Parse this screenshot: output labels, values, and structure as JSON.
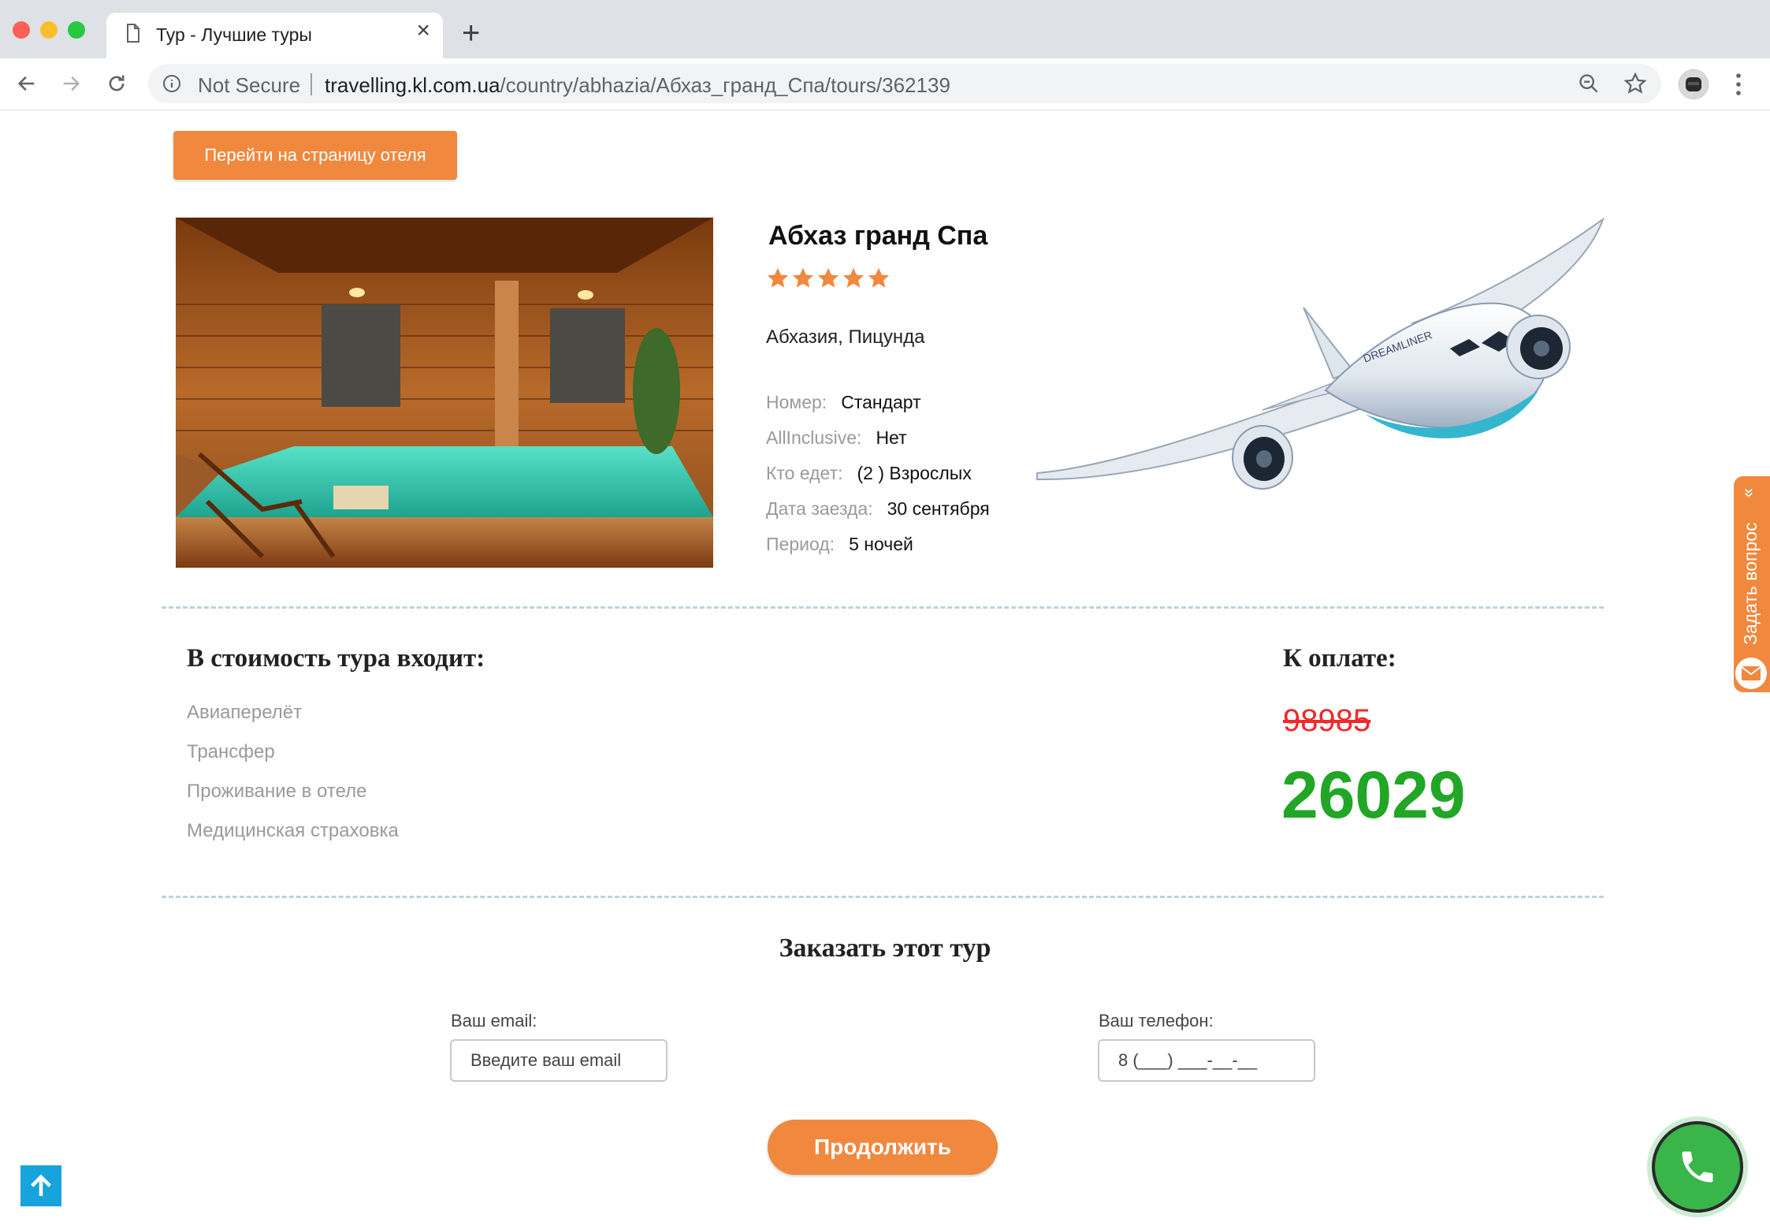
{
  "browser": {
    "tab_title": "Тур - Лучшие туры",
    "security_label": "Not Secure",
    "url_host": "travelling.kl.com.ua",
    "url_path": "/country/abhazia/Абхаз_гранд_Спа/tours/362139"
  },
  "page": {
    "hotel_page_button": "Перейти на страницу отеля",
    "hotel": {
      "name": "Абхаз гранд Спа",
      "stars": 5,
      "location": "Абхазия, Пицунда"
    },
    "params": [
      {
        "key": "Номер:",
        "value": "Стандарт"
      },
      {
        "key": "AllInclusive:",
        "value": "Нет"
      },
      {
        "key": "Кто едет:",
        "value": "(2 ) Взрослых"
      },
      {
        "key": "Дата заезда:",
        "value": "30 сентября"
      },
      {
        "key": "Период:",
        "value": "5 ночей"
      }
    ],
    "included_title": "В стоимость тура входит:",
    "included_items": [
      "Авиаперелёт",
      "Трансфер",
      "Проживание в отеле",
      "Медицинская страховка"
    ],
    "payment_title": "К оплате:",
    "old_price": "98985",
    "new_price": "26029",
    "order_title": "Заказать этот тур",
    "email_label": "Ваш email:",
    "email_placeholder": "Введите ваш email",
    "phone_label": "Ваш телефон:",
    "phone_placeholder": "8 (___) ___-__-__",
    "continue_button": "Продолжить",
    "ask_question": "Задать вопрос"
  },
  "colors": {
    "accent_orange": "#f0883e",
    "old_price_red": "#ee2a2a",
    "new_price_green": "#21a626",
    "call_green": "#39b54a",
    "scroll_blue": "#17a3db"
  },
  "icons": [
    "page-icon",
    "close-icon",
    "plus-icon",
    "back-icon",
    "forward-icon",
    "reload-icon",
    "info-icon",
    "zoom-icon",
    "star-icon",
    "kebab-icon",
    "mail-icon",
    "arrow-up-icon",
    "phone-icon",
    "chevron-double-icon"
  ]
}
